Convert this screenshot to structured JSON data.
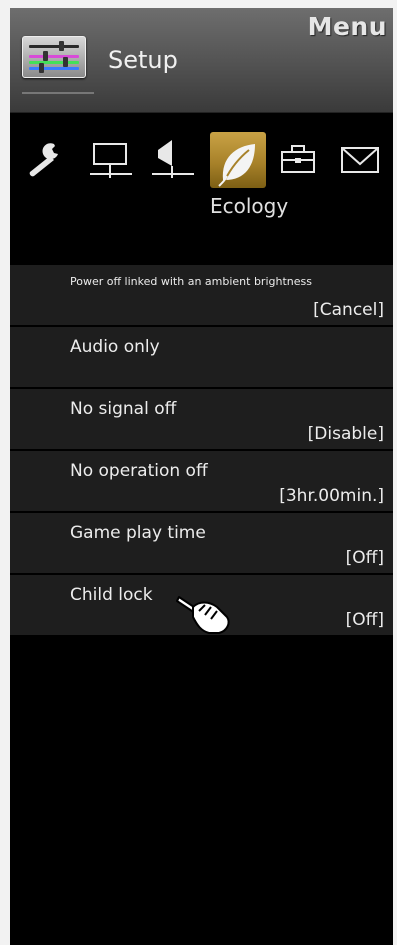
{
  "header": {
    "menu_title": "Menu",
    "section_title": "Setup",
    "section_icon": "sliders-icon"
  },
  "tabs": {
    "items": [
      {
        "name": "wrench-icon",
        "selected": false
      },
      {
        "name": "display-icon",
        "selected": false
      },
      {
        "name": "speaker-icon",
        "selected": false
      },
      {
        "name": "leaf-icon",
        "selected": true
      },
      {
        "name": "toolbox-icon",
        "selected": false
      },
      {
        "name": "envelope-icon",
        "selected": false
      }
    ],
    "selected_caption": "Ecology",
    "selected_color": "#b8902e"
  },
  "settings": [
    {
      "label": "Power off linked with an ambient brightness",
      "value": "[Cancel]"
    },
    {
      "label": "Audio only",
      "value": ""
    },
    {
      "label": "No signal off",
      "value": "[Disable]"
    },
    {
      "label": "No operation off",
      "value": "[3hr.00min.]"
    },
    {
      "label": "Game play time",
      "value": "[Off]"
    },
    {
      "label": "Child lock",
      "value": "[Off]"
    }
  ],
  "cursor": "pointing-hand-icon"
}
